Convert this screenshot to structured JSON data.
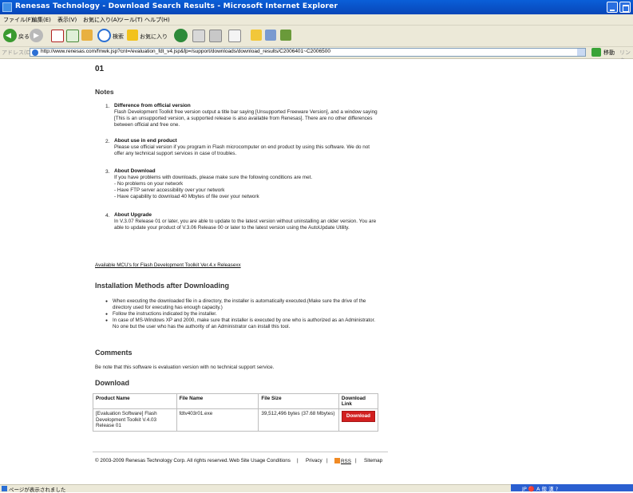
{
  "window": {
    "title": "Renesas Technology - Download Search Results - Microsoft Internet Explorer"
  },
  "menubar": {
    "items": [
      "ファイル(F)",
      "編集(E)",
      "表示(V)",
      "お気に入り(A)",
      "ツール(T)",
      "ヘルプ(H)"
    ]
  },
  "toolbar": {
    "back_label": "戻る",
    "search_label": "検索",
    "favorites_label": "お気に入り"
  },
  "addressbar": {
    "label": "アドレス(D)",
    "url": "http://www.renesas.com/fmwk.jsp?cnt=/evaluation_fdt_v4.jsp&fp=/support/downloads/download_results/C2006401~C2006500",
    "go_label": "移動",
    "links_label": "リンク"
  },
  "page": {
    "release_fragment": "01",
    "notes_heading": "Notes",
    "notes": [
      {
        "num": "1.",
        "title": "Difference from official version",
        "body": "Flash Development Toolkit free version output a title bar saying [Unsupported Freeware Version], and a window saying [This is an unsupported version, a supported release is also available from Renesas]. There are no other differences between official and free one."
      },
      {
        "num": "2.",
        "title": "About use in end product",
        "body": "Please use official version if you program in Flash microcomputer on end product by using this software. We do not offer any technical support services in case of troubles."
      },
      {
        "num": "3.",
        "title": "About Download",
        "body": "If you have problems with downloads, please make sure the following conditions are met.",
        "conditions": [
          "- No problems on your network",
          "- Have FTP server accessibility over your network",
          "- Have capability to download 40 Mbytes of file over your network"
        ]
      },
      {
        "num": "4.",
        "title": "About Upgrade",
        "body": "In V.3.07 Release 01 or later, you are able to update to the latest version without uninstalling an older version. You are able to update your product of V.3.06 Release 00 or later to the latest version using the AutoUpdate Utility."
      }
    ],
    "mcu_link": "Available MCU's for Flash Development Toolkit Ver.4.x Releasexx",
    "install_heading": "Installation Methods after Downloading",
    "install_bullets": [
      "When executing the downloaded file in a directory, the installer is automatically executed.(Make sure the drive of the directory used for executing has enough capacity.)",
      "Follow the instructions indicated by the installer.",
      "In case of MS-Windows XP and 2000, make sure that installer is executed by one who is authorized as an Administrator. No one but the user who has the authority of an Administrator can install this tool."
    ],
    "comments_heading": "Comments",
    "comments_text": "Be note that this software is evaluation version with no technical support service.",
    "download_heading": "Download",
    "table": {
      "headers": [
        "Product Name",
        "File Name",
        "File Size",
        "Download Link"
      ],
      "row": {
        "product": "[Evaluation Software] Flash Development Toolkit V.4.03 Release 01",
        "file": "fdtv403r01.exe",
        "size": "39,512,496 bytes (37.68 Mbytes)",
        "button": "Download"
      }
    },
    "footer": {
      "copyright": "© 2003-2009 Renesas Technology Corp. All rights reserved.",
      "links": [
        "Web Site Usage Conditions",
        "Privacy",
        "RSS",
        "Sitemap"
      ],
      "separator": "|"
    }
  },
  "statusbar": {
    "text": "ページが表示されました",
    "tray": "JP 🔴 A 般 漢 ?"
  },
  "colors": {
    "titlebar": "#0a5fd8",
    "download_button": "#d21f1f",
    "chrome": "#ece9d8"
  }
}
